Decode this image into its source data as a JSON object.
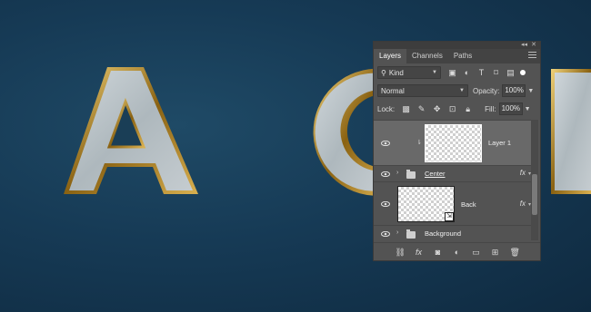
{
  "colors": {
    "background_dark": "#0f2a40",
    "background_mid": "#1f4a66",
    "gold_bevel": "#b78a1e",
    "panel_bg": "#535353",
    "selected_row": "#696969"
  },
  "panel": {
    "tabs": [
      "Layers",
      "Channels",
      "Paths"
    ],
    "filter": {
      "kind_label": "Kind",
      "icons": [
        "image-filter-icon",
        "adjustment-filter-icon",
        "type-filter-icon",
        "shape-filter-icon",
        "smart-object-filter-icon"
      ]
    },
    "blend": {
      "mode": "Normal",
      "opacity_label": "Opacity:",
      "opacity_value": "100%"
    },
    "lock": {
      "label": "Lock:",
      "fill_label": "Fill:",
      "fill_value": "100%"
    },
    "layers": [
      {
        "name": "Layer 1",
        "type": "pixel",
        "selected": true,
        "linked": true
      },
      {
        "name": "Center",
        "type": "group",
        "fx": "fx"
      },
      {
        "name": "Back",
        "type": "smart-object",
        "fx": "fx"
      },
      {
        "name": "Background",
        "type": "group"
      }
    ],
    "bottom_icons": [
      "link-layers-icon",
      "layer-style-icon",
      "layer-mask-icon",
      "adjustment-layer-icon",
      "new-group-icon",
      "new-layer-icon",
      "delete-layer-icon"
    ]
  },
  "glyphs": {
    "icon_fx": "fx",
    "icon_collapse": "◂◂",
    "icon_close": "✕"
  }
}
